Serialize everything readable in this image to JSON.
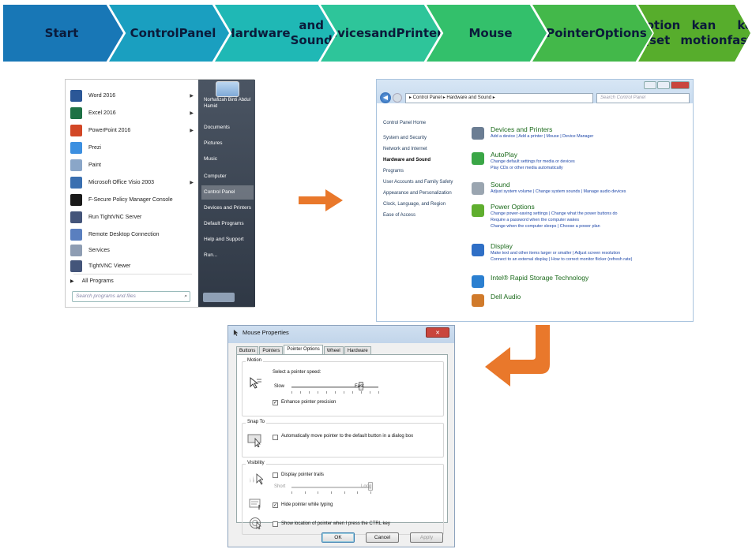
{
  "steps": [
    {
      "lines": [
        "Start"
      ],
      "color": "#1877b6"
    },
    {
      "lines": [
        "Control",
        "Panel"
      ],
      "color": "#1a9fc0"
    },
    {
      "lines": [
        "Hardware",
        "and Sound"
      ],
      "color": "#1fb8b5"
    },
    {
      "lines": [
        "Devices",
        "and",
        "Printers"
      ],
      "color": "#2ec59a"
    },
    {
      "lines": [
        "Mouse"
      ],
      "color": "#33c06b"
    },
    {
      "lines": [
        "Pointer",
        "Options"
      ],
      "color": "#43b84a"
    },
    {
      "lines": [
        "motion (set",
        "kan motion",
        "ke fast)."
      ],
      "color": "#57ad2c"
    }
  ],
  "start_menu": {
    "items": [
      {
        "label": "Word 2016",
        "color": "#2b5797",
        "arrow": true
      },
      {
        "label": "Excel 2016",
        "color": "#1e7145",
        "arrow": true
      },
      {
        "label": "PowerPoint 2016",
        "color": "#d24726",
        "arrow": true
      },
      {
        "label": "Prezi",
        "color": "#3c8fe0",
        "arrow": false
      },
      {
        "label": "Paint",
        "color": "#8aa6c8",
        "arrow": false
      },
      {
        "label": "Microsoft Office Visio 2003",
        "color": "#3a6fb0",
        "arrow": true
      },
      {
        "label": "F-Secure Policy Manager Console",
        "color": "#1a1a1a",
        "arrow": false
      },
      {
        "label": "Run TightVNC Server",
        "color": "#44557a",
        "arrow": false
      },
      {
        "label": "Remote Desktop Connection",
        "color": "#5a7fbf",
        "arrow": false
      },
      {
        "label": "Services",
        "color": "#8e9db3",
        "arrow": false
      },
      {
        "label": "TightVNC Viewer",
        "color": "#44557a",
        "arrow": false
      }
    ],
    "all_programs": "All Programs",
    "search_placeholder": "Search programs and files",
    "right_items": [
      {
        "label": "Norhafizah Binti Abdul Hamid"
      },
      {
        "label": "Documents"
      },
      {
        "label": "Pictures"
      },
      {
        "label": "Music"
      },
      {
        "label": "Computer"
      },
      {
        "label": "Control Panel"
      },
      {
        "label": "Devices and Printers"
      },
      {
        "label": "Default Programs"
      },
      {
        "label": "Help and Support"
      },
      {
        "label": "Run..."
      }
    ]
  },
  "control_panel": {
    "address": "▸ Control Panel ▸ Hardware and Sound ▸",
    "search_placeholder": "Search Control Panel",
    "sidebar": [
      "Control Panel Home",
      "System and Security",
      "Network and Internet",
      "Hardware and Sound",
      "Programs",
      "User Accounts and Family Safety",
      "Appearance and Personalization",
      "Clock, Language, and Region",
      "Ease of Access"
    ],
    "categories": [
      {
        "title": "Devices and Printers",
        "color": "#6b7d93",
        "links": [
          "Add a device  |  Add a printer  |  Mouse  |  Device Manager"
        ]
      },
      {
        "title": "AutoPlay",
        "color": "#3aa646",
        "links": [
          "Change default settings for media or devices",
          "Play CDs or other media automatically"
        ]
      },
      {
        "title": "Sound",
        "color": "#9aa5b0",
        "links": [
          "Adjust system volume  |  Change system sounds  |  Manage audio devices"
        ]
      },
      {
        "title": "Power Options",
        "color": "#5fae2e",
        "links": [
          "Change power-saving settings  |  Change what the power buttons do",
          "Require a password when the computer wakes",
          "Change when the computer sleeps  |  Choose a power plan"
        ]
      },
      {
        "title": "Display",
        "color": "#2f6fc6",
        "links": [
          "Make text and other items larger or smaller  |  Adjust screen resolution",
          "Connect to an external display  |  How to correct monitor flicker (refresh rate)"
        ]
      },
      {
        "title": "Intel® Rapid Storage Technology",
        "color": "#2b7fd0",
        "links": []
      },
      {
        "title": "Dell Audio",
        "color": "#d07a2b",
        "links": []
      }
    ]
  },
  "mouse_props": {
    "title": "Mouse Properties",
    "close": "✕",
    "tabs": [
      "Buttons",
      "Pointers",
      "Pointer Options",
      "Wheel",
      "Hardware"
    ],
    "motion": {
      "group": "Motion",
      "label": "Select a pointer speed:",
      "slow": "Slow",
      "fast": "Fast",
      "speed_fraction": 0.8,
      "enhance": "Enhance pointer precision",
      "enhance_checked": true
    },
    "snap": {
      "group": "Snap To",
      "label": "Automatically move pointer to the default button in a dialog box",
      "checked": false
    },
    "visibility": {
      "group": "Visibility",
      "trails": "Display pointer trails",
      "trails_checked": false,
      "short": "Short",
      "long": "Long",
      "trails_fraction": 1.0,
      "hide": "Hide pointer while typing",
      "hide_checked": true,
      "show_ctrl": "Show location of pointer when I press the CTRL key",
      "show_checked": false
    },
    "buttons": {
      "ok": "OK",
      "cancel": "Cancel",
      "apply": "Apply"
    }
  },
  "arrow_color": "#e9782b"
}
